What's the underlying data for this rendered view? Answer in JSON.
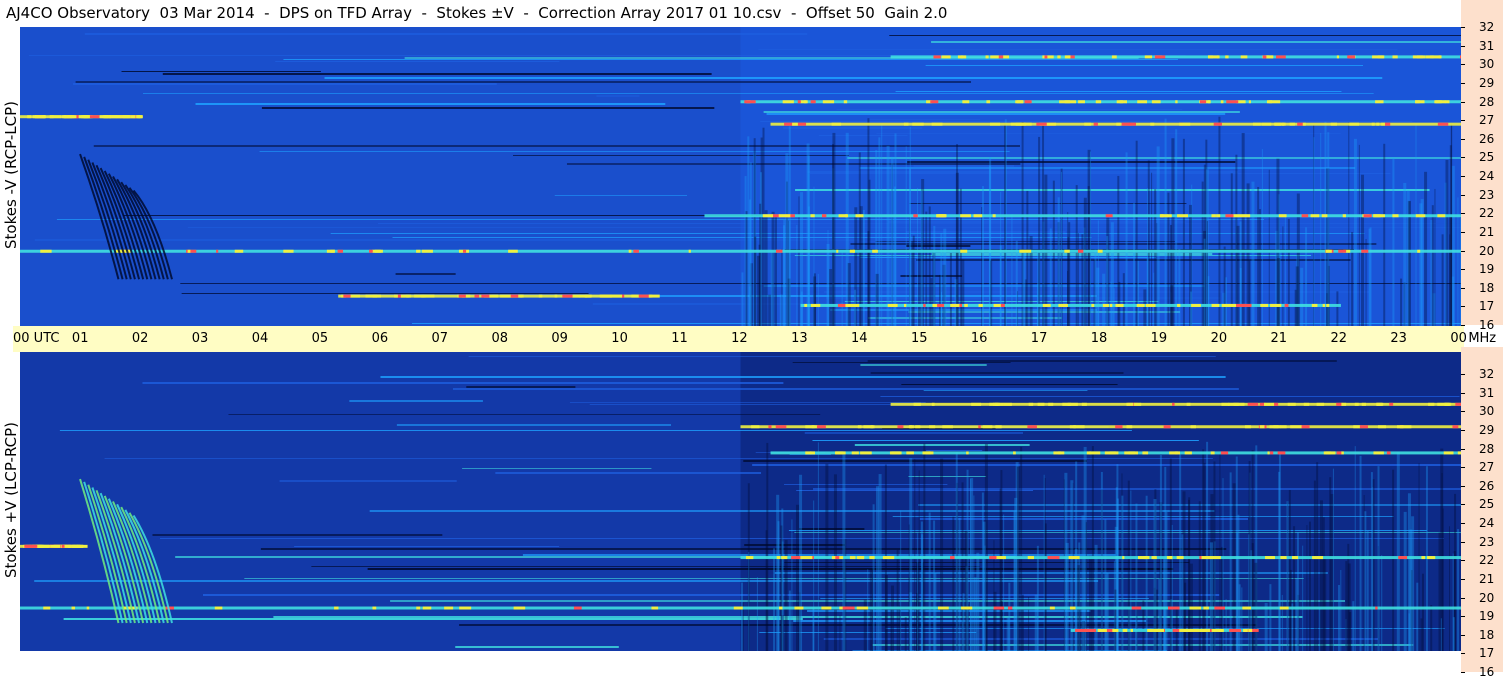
{
  "title": "AJ4CO Observatory  03 Mar 2014  -  DPS on TFD Array  -  Stokes ±V  -  Correction Array 2017 01 10.csv  -  Offset 50  Gain 2.0",
  "panel_top_label": "Stokes -V (RCP-LCP)",
  "panel_bottom_label": "Stokes +V (LCP-RCP)",
  "time_axis": {
    "labels": [
      "00  UTC",
      "01",
      "02",
      "03",
      "04",
      "05",
      "06",
      "07",
      "08",
      "09",
      "10",
      "11",
      "12",
      "13",
      "14",
      "15",
      "16",
      "17",
      "18",
      "19",
      "20",
      "21",
      "22",
      "23",
      "00"
    ],
    "unit": "MHz"
  },
  "freq_labels": [
    "32",
    "31",
    "30",
    "29",
    "28",
    "27",
    "26",
    "25",
    "24",
    "23",
    "22",
    "21",
    "20",
    "19",
    "18",
    "17",
    "16"
  ],
  "chart_data": [
    {
      "type": "heatmap",
      "title": "Stokes -V (RCP-LCP)",
      "xlabel": "UTC",
      "ylabel": "MHz",
      "xlim": [
        0,
        24
      ],
      "ylim": [
        16,
        32
      ],
      "colors": [
        "#000a30",
        "#0a2fa0",
        "#1e5fe0",
        "#1ea0ff",
        "#40e0e0",
        "#f0f040",
        "#ff5050"
      ],
      "burst": {
        "start_hour": 1.0,
        "end_hour": 2.6,
        "freq_high": 25.2,
        "freq_low": 18.5
      },
      "bands": [
        {
          "freq": 27.2,
          "start_hour": 0.0,
          "end_hour": 2.0
        },
        {
          "freq": 20.0,
          "start_hour": 0.0,
          "end_hour": 24.0
        },
        {
          "freq": 21.9,
          "start_hour": 11.4,
          "end_hour": 24.0
        },
        {
          "freq": 17.6,
          "start_hour": 5.3,
          "end_hour": 10.5
        },
        {
          "freq": 17.1,
          "start_hour": 13.0,
          "end_hour": 22.0
        },
        {
          "freq": 28.0,
          "start_hour": 12.0,
          "end_hour": 24.0
        },
        {
          "freq": 26.8,
          "start_hour": 12.5,
          "end_hour": 24.0
        },
        {
          "freq": 30.4,
          "start_hour": 14.5,
          "end_hour": 24.0
        }
      ]
    },
    {
      "type": "heatmap",
      "title": "Stokes +V (LCP-RCP)",
      "xlabel": "UTC",
      "ylabel": "MHz",
      "xlim": [
        0,
        24
      ],
      "ylim": [
        16,
        32
      ],
      "colors": [
        "#000a30",
        "#0a2fa0",
        "#1e5fe0",
        "#1ea0ff",
        "#40e0e0",
        "#f0f040",
        "#ff5050"
      ],
      "burst": {
        "start_hour": 1.0,
        "end_hour": 2.6,
        "freq_high": 25.2,
        "freq_low": 17.5
      },
      "bands": [
        {
          "freq": 21.6,
          "start_hour": 0.0,
          "end_hour": 1.0
        },
        {
          "freq": 18.3,
          "start_hour": 0.0,
          "end_hour": 24.0
        },
        {
          "freq": 17.1,
          "start_hour": 17.5,
          "end_hour": 20.5
        },
        {
          "freq": 28.0,
          "start_hour": 12.0,
          "end_hour": 24.0
        },
        {
          "freq": 26.6,
          "start_hour": 12.5,
          "end_hour": 24.0
        },
        {
          "freq": 21.0,
          "start_hour": 12.0,
          "end_hour": 24.0
        },
        {
          "freq": 29.2,
          "start_hour": 14.5,
          "end_hour": 24.0
        }
      ]
    }
  ]
}
